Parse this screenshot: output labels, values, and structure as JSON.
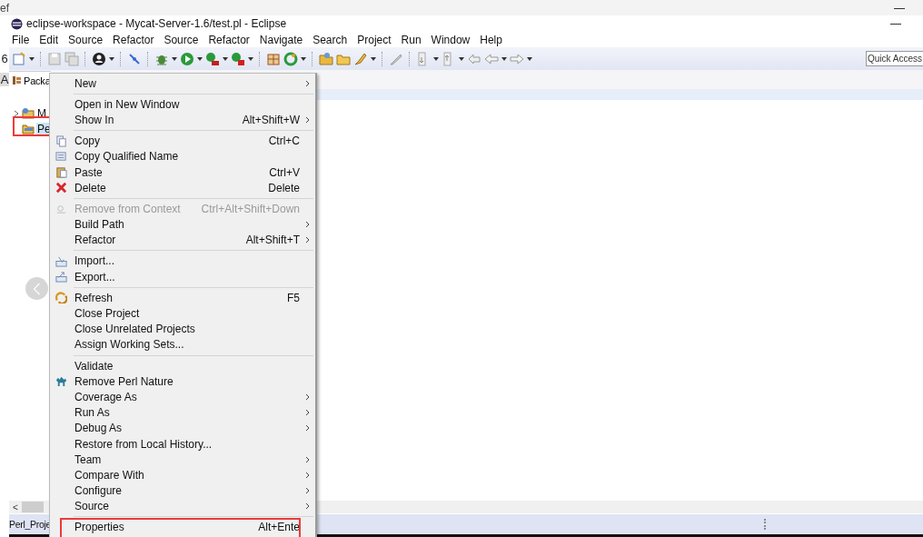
{
  "background_window": {
    "title_fragment": "ef",
    "minimize": "—",
    "edge_chars": [
      "6",
      "A"
    ]
  },
  "window": {
    "title": "eclipse-workspace - Mycat-Server-1.6/test.pl - Eclipse",
    "minimize": "—"
  },
  "menu_bar": [
    "File",
    "Edit",
    "Source",
    "Refactor",
    "Source",
    "Refactor",
    "Navigate",
    "Search",
    "Project",
    "Run",
    "Window",
    "Help"
  ],
  "quick_access": {
    "placeholder": "Quick Access"
  },
  "view_tab": {
    "label": "Packa",
    "selected": true
  },
  "tree": [
    {
      "label": "M",
      "has_children": true,
      "selected": false,
      "annotated": false
    },
    {
      "label": "Pe",
      "has_children": false,
      "selected": true,
      "annotated": true
    }
  ],
  "context_menu": [
    {
      "kind": "item",
      "label": "New",
      "submenu": true,
      "disabled": false,
      "annotated": false
    },
    {
      "kind": "separator"
    },
    {
      "kind": "item",
      "label": "Open in New Window",
      "submenu": false,
      "disabled": false,
      "annotated": false
    },
    {
      "kind": "item",
      "label": "Show In",
      "shortcut": "Alt+Shift+W",
      "submenu": true,
      "disabled": false,
      "annotated": false
    },
    {
      "kind": "separator"
    },
    {
      "kind": "item",
      "label": "Copy",
      "shortcut": "Ctrl+C",
      "submenu": false,
      "disabled": false,
      "annotated": false
    },
    {
      "kind": "item",
      "label": "Copy Qualified Name",
      "submenu": false,
      "disabled": false,
      "annotated": false
    },
    {
      "kind": "item",
      "label": "Paste",
      "shortcut": "Ctrl+V",
      "submenu": false,
      "disabled": false,
      "annotated": false
    },
    {
      "kind": "item",
      "label": "Delete",
      "shortcut": "Delete",
      "submenu": false,
      "disabled": false,
      "annotated": false
    },
    {
      "kind": "separator"
    },
    {
      "kind": "item",
      "label": "Remove from Context",
      "shortcut": "Ctrl+Alt+Shift+Down",
      "submenu": false,
      "disabled": true,
      "annotated": false
    },
    {
      "kind": "item",
      "label": "Build Path",
      "submenu": true,
      "disabled": false,
      "annotated": false
    },
    {
      "kind": "item",
      "label": "Refactor",
      "shortcut": "Alt+Shift+T",
      "submenu": true,
      "disabled": false,
      "annotated": false
    },
    {
      "kind": "separator"
    },
    {
      "kind": "item",
      "label": "Import...",
      "submenu": false,
      "disabled": false,
      "annotated": false
    },
    {
      "kind": "item",
      "label": "Export...",
      "submenu": false,
      "disabled": false,
      "annotated": false
    },
    {
      "kind": "separator"
    },
    {
      "kind": "item",
      "label": "Refresh",
      "shortcut": "F5",
      "submenu": false,
      "disabled": false,
      "annotated": false
    },
    {
      "kind": "item",
      "label": "Close Project",
      "submenu": false,
      "disabled": false,
      "annotated": false
    },
    {
      "kind": "item",
      "label": "Close Unrelated Projects",
      "submenu": false,
      "disabled": false,
      "annotated": false
    },
    {
      "kind": "item",
      "label": "Assign Working Sets...",
      "submenu": false,
      "disabled": false,
      "annotated": false
    },
    {
      "kind": "separator"
    },
    {
      "kind": "item",
      "label": "Validate",
      "submenu": false,
      "disabled": false,
      "annotated": false
    },
    {
      "kind": "item",
      "label": "Remove Perl Nature",
      "submenu": false,
      "disabled": false,
      "annotated": false
    },
    {
      "kind": "item",
      "label": "Coverage As",
      "submenu": true,
      "disabled": false,
      "annotated": false
    },
    {
      "kind": "item",
      "label": "Run As",
      "submenu": true,
      "disabled": false,
      "annotated": false
    },
    {
      "kind": "item",
      "label": "Debug As",
      "submenu": true,
      "disabled": false,
      "annotated": false
    },
    {
      "kind": "item",
      "label": "Restore from Local History...",
      "submenu": false,
      "disabled": false,
      "annotated": false
    },
    {
      "kind": "item",
      "label": "Team",
      "submenu": true,
      "disabled": false,
      "annotated": false
    },
    {
      "kind": "item",
      "label": "Compare With",
      "submenu": true,
      "disabled": false,
      "annotated": false
    },
    {
      "kind": "item",
      "label": "Configure",
      "submenu": true,
      "disabled": false,
      "annotated": false
    },
    {
      "kind": "item",
      "label": "Source",
      "submenu": true,
      "disabled": false,
      "annotated": false
    },
    {
      "kind": "separator"
    },
    {
      "kind": "item",
      "label": "Properties",
      "shortcut": "Alt+Ente",
      "submenu": false,
      "disabled": false,
      "annotated": true
    }
  ],
  "scrollbar": {
    "left_arrow": "<"
  },
  "status_bar": {
    "text": "Perl_Proje"
  }
}
